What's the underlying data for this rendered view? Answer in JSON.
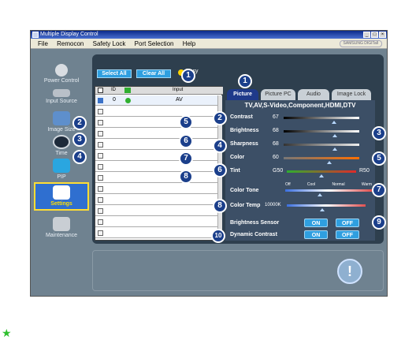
{
  "window": {
    "title": "Multiple Display Control",
    "brand": "SAMSUNG DIGITall"
  },
  "menu": [
    "File",
    "Remocon",
    "Safety Lock",
    "Port Selection",
    "Help"
  ],
  "nav": [
    {
      "label": "Power Control"
    },
    {
      "label": "Input Source"
    },
    {
      "label": "Image Size"
    },
    {
      "label": "Time"
    },
    {
      "label": "PIP"
    },
    {
      "label": "Settings"
    },
    {
      "label": "Maintenance"
    }
  ],
  "toolbar": {
    "select_all": "Select All",
    "clear_all": "Clear All",
    "busy": "Busy"
  },
  "grid": {
    "headers": [
      "ID",
      "Input"
    ],
    "rows": [
      {
        "id": "0",
        "input": "AV"
      }
    ]
  },
  "tabs": [
    "Picture",
    "Picture PC",
    "Audio",
    "Image Lock"
  ],
  "picture": {
    "source_line": "TV,AV,S-Video,Component,HDMI,DTV",
    "contrast": {
      "label": "Contrast",
      "value": "67",
      "level": 0.67
    },
    "brightness": {
      "label": "Brightness",
      "value": "68",
      "level": 0.68
    },
    "sharpness": {
      "label": "Sharpness",
      "value": "68",
      "level": 0.68
    },
    "color": {
      "label": "Color",
      "value": "60",
      "level": 0.6
    },
    "tint": {
      "label": "Tint",
      "left": "G50",
      "right": "R50",
      "level": 0.5
    },
    "color_tone": {
      "label": "Color Tone",
      "options": [
        "Off",
        "Cool",
        "Normal",
        "Warm"
      ],
      "level": 0.4
    },
    "color_temp": {
      "label": "Color Temp",
      "value": "10000K",
      "level": 0.45
    },
    "brightness_sensor": {
      "label": "Brightness Sensor",
      "on": "ON",
      "off": "OFF"
    },
    "dynamic_contrast": {
      "label": "Dynamic Contrast",
      "on": "ON",
      "off": "OFF"
    }
  },
  "callouts": [
    "1",
    "2",
    "3",
    "4",
    "5",
    "6",
    "7",
    "8",
    "9",
    "10"
  ]
}
